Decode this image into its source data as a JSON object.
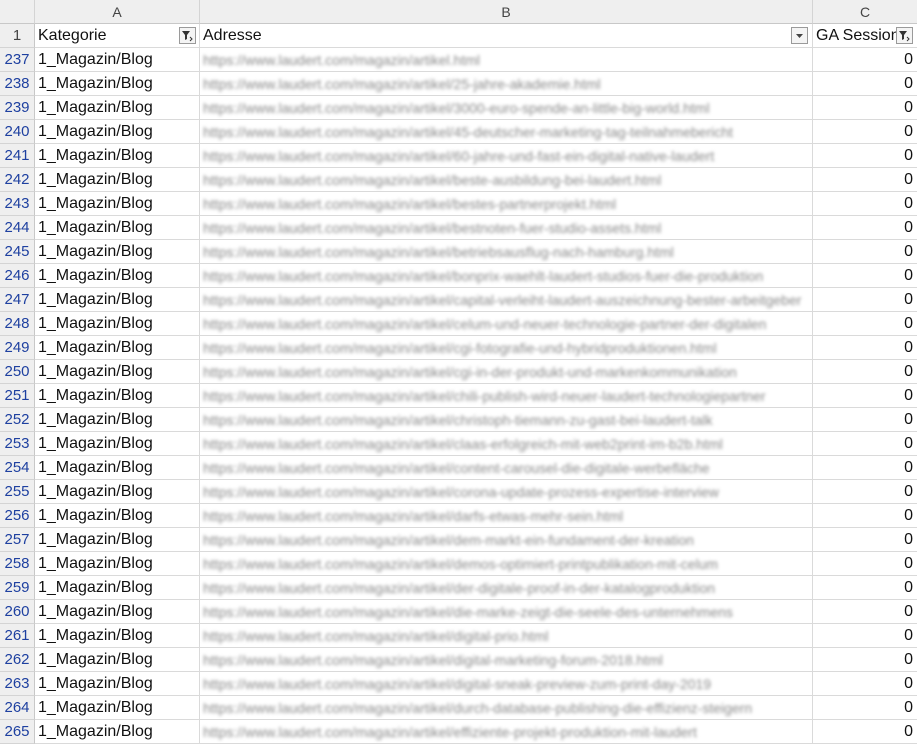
{
  "columns": [
    "A",
    "B",
    "C"
  ],
  "header_row": {
    "number": "1",
    "kategorie": "Kategorie",
    "adresse": "Adresse",
    "ga_sessions": "GA Session"
  },
  "rows": [
    {
      "n": "237",
      "kategorie": "1_Magazin/Blog",
      "adresse": "https://www.laudert.com/magazin/artikel.html",
      "sessions": "0"
    },
    {
      "n": "238",
      "kategorie": "1_Magazin/Blog",
      "adresse": "https://www.laudert.com/magazin/artikel/25-jahre-akademie.html",
      "sessions": "0"
    },
    {
      "n": "239",
      "kategorie": "1_Magazin/Blog",
      "adresse": "https://www.laudert.com/magazin/artikel/3000-euro-spende-an-little-big-world.html",
      "sessions": "0"
    },
    {
      "n": "240",
      "kategorie": "1_Magazin/Blog",
      "adresse": "https://www.laudert.com/magazin/artikel/45-deutscher-marketing-tag-teilnahmebericht",
      "sessions": "0"
    },
    {
      "n": "241",
      "kategorie": "1_Magazin/Blog",
      "adresse": "https://www.laudert.com/magazin/artikel/60-jahre-und-fast-ein-digital-native-laudert",
      "sessions": "0"
    },
    {
      "n": "242",
      "kategorie": "1_Magazin/Blog",
      "adresse": "https://www.laudert.com/magazin/artikel/beste-ausbildung-bei-laudert.html",
      "sessions": "0"
    },
    {
      "n": "243",
      "kategorie": "1_Magazin/Blog",
      "adresse": "https://www.laudert.com/magazin/artikel/bestes-partnerprojekt.html",
      "sessions": "0"
    },
    {
      "n": "244",
      "kategorie": "1_Magazin/Blog",
      "adresse": "https://www.laudert.com/magazin/artikel/bestnoten-fuer-studio-assets.html",
      "sessions": "0"
    },
    {
      "n": "245",
      "kategorie": "1_Magazin/Blog",
      "adresse": "https://www.laudert.com/magazin/artikel/betriebsausflug-nach-hamburg.html",
      "sessions": "0"
    },
    {
      "n": "246",
      "kategorie": "1_Magazin/Blog",
      "adresse": "https://www.laudert.com/magazin/artikel/bonprix-waehlt-laudert-studios-fuer-die-produktion",
      "sessions": "0"
    },
    {
      "n": "247",
      "kategorie": "1_Magazin/Blog",
      "adresse": "https://www.laudert.com/magazin/artikel/capital-verleiht-laudert-auszeichnung-bester-arbeitgeber",
      "sessions": "0"
    },
    {
      "n": "248",
      "kategorie": "1_Magazin/Blog",
      "adresse": "https://www.laudert.com/magazin/artikel/celum-und-neuer-technologie-partner-der-digitalen",
      "sessions": "0"
    },
    {
      "n": "249",
      "kategorie": "1_Magazin/Blog",
      "adresse": "https://www.laudert.com/magazin/artikel/cgi-fotografie-und-hybridproduktionen.html",
      "sessions": "0"
    },
    {
      "n": "250",
      "kategorie": "1_Magazin/Blog",
      "adresse": "https://www.laudert.com/magazin/artikel/cgi-in-der-produkt-und-markenkommunikation",
      "sessions": "0"
    },
    {
      "n": "251",
      "kategorie": "1_Magazin/Blog",
      "adresse": "https://www.laudert.com/magazin/artikel/chili-publish-wird-neuer-laudert-technologiepartner",
      "sessions": "0"
    },
    {
      "n": "252",
      "kategorie": "1_Magazin/Blog",
      "adresse": "https://www.laudert.com/magazin/artikel/christoph-tiemann-zu-gast-bei-laudert-talk",
      "sessions": "0"
    },
    {
      "n": "253",
      "kategorie": "1_Magazin/Blog",
      "adresse": "https://www.laudert.com/magazin/artikel/claas-erfolgreich-mit-web2print-im-b2b.html",
      "sessions": "0"
    },
    {
      "n": "254",
      "kategorie": "1_Magazin/Blog",
      "adresse": "https://www.laudert.com/magazin/artikel/content-carousel-die-digitale-werbefläche",
      "sessions": "0"
    },
    {
      "n": "255",
      "kategorie": "1_Magazin/Blog",
      "adresse": "https://www.laudert.com/magazin/artikel/corona-update-prozess-expertise-interview",
      "sessions": "0"
    },
    {
      "n": "256",
      "kategorie": "1_Magazin/Blog",
      "adresse": "https://www.laudert.com/magazin/artikel/darfs-etwas-mehr-sein.html",
      "sessions": "0"
    },
    {
      "n": "257",
      "kategorie": "1_Magazin/Blog",
      "adresse": "https://www.laudert.com/magazin/artikel/dem-markt-ein-fundament-der-kreation",
      "sessions": "0"
    },
    {
      "n": "258",
      "kategorie": "1_Magazin/Blog",
      "adresse": "https://www.laudert.com/magazin/artikel/demos-optimiert-printpublikation-mit-celum",
      "sessions": "0"
    },
    {
      "n": "259",
      "kategorie": "1_Magazin/Blog",
      "adresse": "https://www.laudert.com/magazin/artikel/der-digitale-proof-in-der-katalogproduktion",
      "sessions": "0"
    },
    {
      "n": "260",
      "kategorie": "1_Magazin/Blog",
      "adresse": "https://www.laudert.com/magazin/artikel/die-marke-zeigt-die-seele-des-unternehmens",
      "sessions": "0"
    },
    {
      "n": "261",
      "kategorie": "1_Magazin/Blog",
      "adresse": "https://www.laudert.com/magazin/artikel/digital-prio.html",
      "sessions": "0"
    },
    {
      "n": "262",
      "kategorie": "1_Magazin/Blog",
      "adresse": "https://www.laudert.com/magazin/artikel/digital-marketing-forum-2018.html",
      "sessions": "0"
    },
    {
      "n": "263",
      "kategorie": "1_Magazin/Blog",
      "adresse": "https://www.laudert.com/magazin/artikel/digital-sneak-preview-zum-print-day-2019",
      "sessions": "0"
    },
    {
      "n": "264",
      "kategorie": "1_Magazin/Blog",
      "adresse": "https://www.laudert.com/magazin/artikel/durch-database-publishing-die-effizienz-steigern",
      "sessions": "0"
    },
    {
      "n": "265",
      "kategorie": "1_Magazin/Blog",
      "adresse": "https://www.laudert.com/magazin/artikel/effiziente-projekt-produktion-mit-laudert",
      "sessions": "0"
    }
  ]
}
